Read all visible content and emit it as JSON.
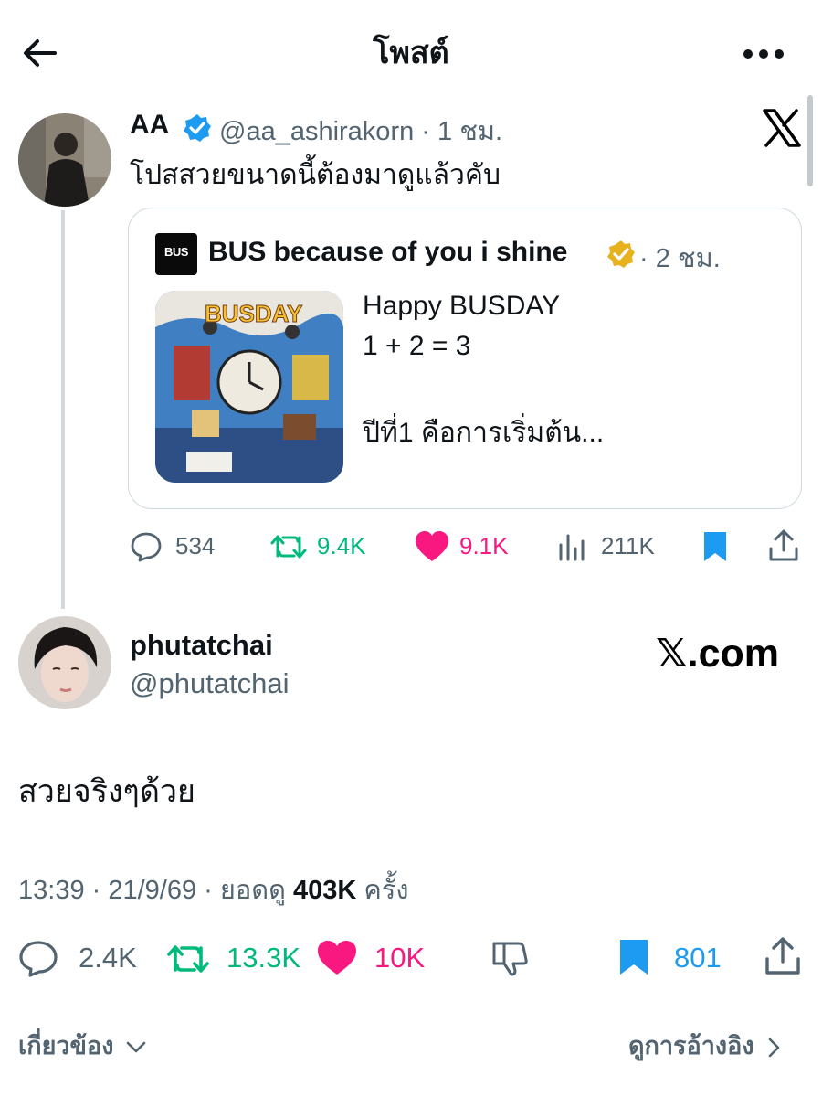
{
  "header": {
    "title": "โพสต์",
    "back_icon": "arrow-left-icon",
    "more_icon": "more-horizontal-icon"
  },
  "quoted_tweet": {
    "display_name": "AA",
    "handle": "@aa_ashirakorn",
    "time": "· 1 ชม.",
    "text": "โปสสวยขนาดนี้ต้องมาดูแล้วคับ",
    "embedded": {
      "account_name": "BUS because of you i shine",
      "time": "· 2 ชม.",
      "logo_text": "BUS",
      "lines": [
        "Happy BUSDAY",
        "1 + 2 = 3",
        "ปีที่1 คือการเริ่มต้น..."
      ]
    },
    "stats": {
      "replies": "534",
      "reposts": "9.4K",
      "likes": "9.1K",
      "views": "211K"
    }
  },
  "main_tweet": {
    "display_name": "phutatchai",
    "handle": "@phutatchai",
    "watermark": "𝕏.com",
    "text": "สวยจริงๆด้วย",
    "meta_prefix": "13:39 · 21/9/69 · ยอดดู",
    "meta_views": "403K",
    "meta_suffix": "ครั้ง",
    "stats": {
      "replies": "2.4K",
      "reposts": "13.3K",
      "likes": "10K",
      "bookmarks": "801"
    }
  },
  "footer": {
    "related": "เกี่ยวข้อง",
    "view_quotes": "ดูการอ้างอิง"
  },
  "colors": {
    "text": "#0f1419",
    "muted": "#536471",
    "repost": "#00ba7c",
    "like": "#f91880",
    "bookmark": "#1d9bf0",
    "verified": "#1d9bf0",
    "gold": "#e8b21e"
  }
}
